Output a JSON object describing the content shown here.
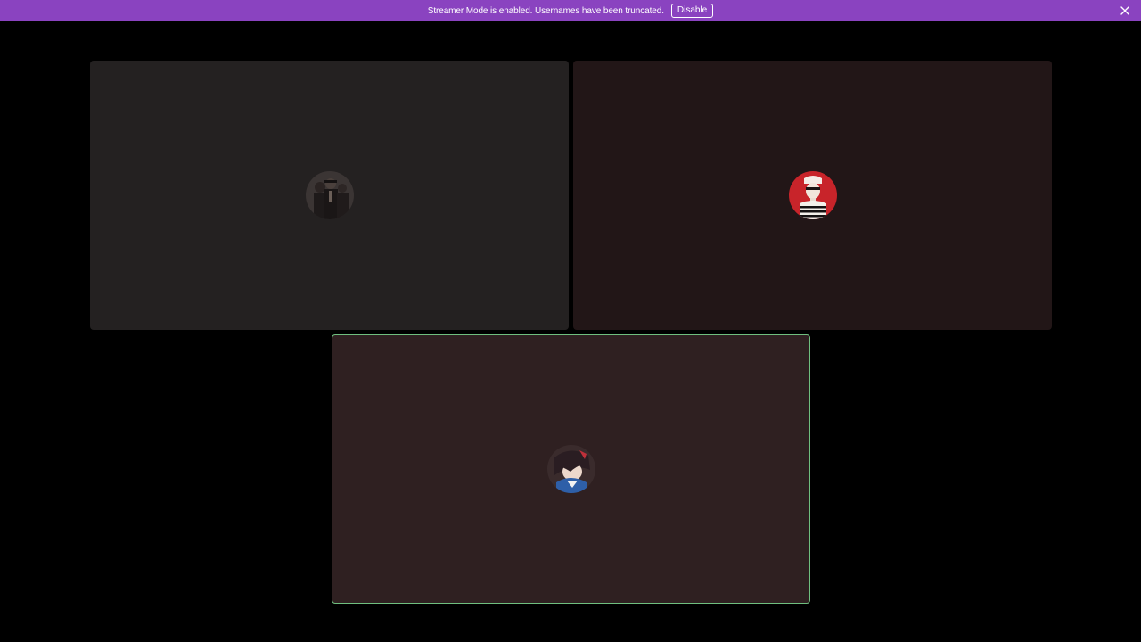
{
  "notice_bar": {
    "message": "Streamer Mode is enabled. Usernames have been truncated.",
    "disable_label": "Disable",
    "close_icon": "close-icon",
    "background": "#8a43c0"
  },
  "tiles": [
    {
      "id": "participant-1",
      "background": "#242121",
      "speaking": false,
      "avatar_icon": "avatar-dark-figures"
    },
    {
      "id": "participant-2",
      "background": "#221617",
      "speaking": false,
      "avatar_icon": "avatar-red-striped-figure"
    },
    {
      "id": "participant-3",
      "background": "#2f2021",
      "speaking": true,
      "speaking_color": "#6fbf7f",
      "avatar_icon": "avatar-anime-character"
    }
  ]
}
